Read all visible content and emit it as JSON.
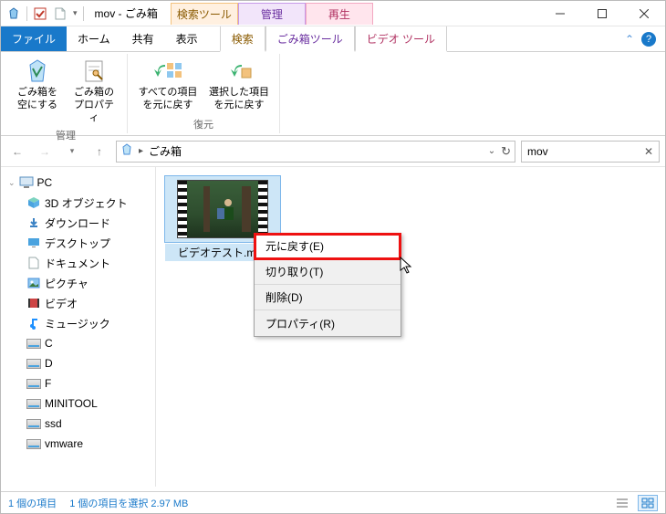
{
  "title": "mov - ごみ箱",
  "contextual_tabs": {
    "search": "検索ツール",
    "bin": "管理",
    "play": "再生"
  },
  "ribbon_tabs": {
    "file": "ファイル",
    "home": "ホーム",
    "share": "共有",
    "view": "表示",
    "search": "検索",
    "bin_tools": "ごみ箱ツール",
    "video_tools": "ビデオ ツール"
  },
  "ribbon": {
    "manage_group": "管理",
    "restore_group": "復元",
    "empty_bin": "ごみ箱を\n空にする",
    "bin_props": "ごみ箱の\nプロパティ",
    "restore_all": "すべての項目\nを元に戻す",
    "restore_selected": "選択した項目\nを元に戻す"
  },
  "breadcrumb": "ごみ箱",
  "search_value": "mov",
  "tree": {
    "pc": "PC",
    "objects3d": "3D オブジェクト",
    "downloads": "ダウンロード",
    "desktop": "デスクトップ",
    "documents": "ドキュメント",
    "pictures": "ピクチャ",
    "videos": "ビデオ",
    "music": "ミュージック",
    "c": "C",
    "d": "D",
    "f": "F",
    "minitool": "MINITOOL",
    "ssd": "ssd",
    "vmware": "vmware"
  },
  "file_name": "ビデオテスト.mov",
  "context_menu": {
    "restore": "元に戻す(E)",
    "cut": "切り取り(T)",
    "delete": "削除(D)",
    "properties": "プロパティ(R)"
  },
  "status": {
    "count": "1 個の項目",
    "selection": "1 個の項目を選択 2.97 MB"
  }
}
